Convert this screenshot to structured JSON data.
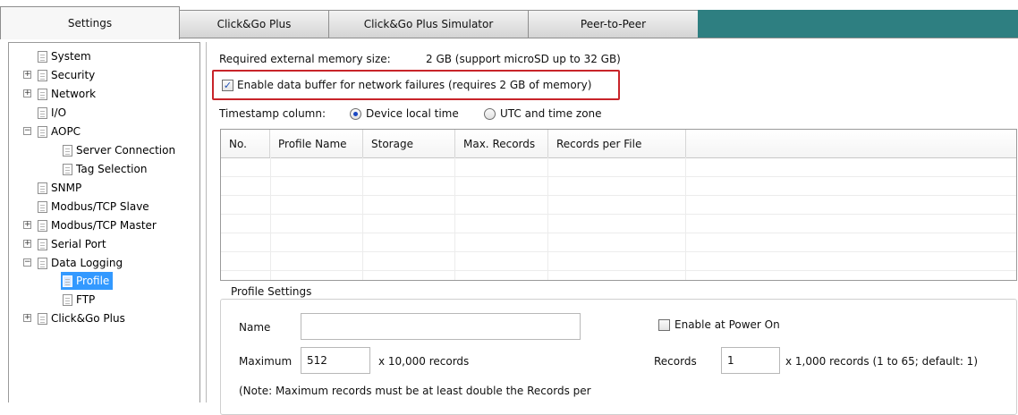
{
  "tabs": [
    {
      "label": "Settings",
      "active": true
    },
    {
      "label": "Click&Go Plus",
      "active": false
    },
    {
      "label": "Click&Go Plus Simulator",
      "active": false
    },
    {
      "label": "Peer-to-Peer",
      "active": false
    }
  ],
  "tree": [
    {
      "label": "System"
    },
    {
      "label": "Security",
      "expander": "+"
    },
    {
      "label": "Network",
      "expander": "+"
    },
    {
      "label": "I/O"
    },
    {
      "label": "AOPC",
      "expander": "−"
    },
    {
      "label": "Server Connection"
    },
    {
      "label": "Tag Selection"
    },
    {
      "label": "SNMP"
    },
    {
      "label": "Modbus/TCP Slave"
    },
    {
      "label": "Modbus/TCP Master",
      "expander": "+"
    },
    {
      "label": "Serial Port",
      "expander": "+"
    },
    {
      "label": "Data Logging",
      "expander": "−"
    },
    {
      "label": "Profile",
      "selected": true
    },
    {
      "label": "FTP"
    },
    {
      "label": "Click&Go Plus",
      "expander": "+"
    }
  ],
  "memory": {
    "label": "Required external memory size:",
    "value": "2  GB (support microSD up to 32 GB)"
  },
  "buffer": {
    "checked_mark": "✓",
    "label": "Enable data buffer for network failures (requires 2 GB of memory)"
  },
  "timestamp": {
    "label": "Timestamp column:",
    "options": [
      {
        "label": "Device local time",
        "selected": true
      },
      {
        "label": "UTC and time zone",
        "selected": false
      }
    ]
  },
  "table": {
    "columns": [
      "No.",
      "Profile Name",
      "Storage",
      "Max. Records",
      "Records per File"
    ]
  },
  "profile_settings": {
    "title": "Profile Settings",
    "name_label": "Name",
    "name_value": "",
    "enable_power_on_label": "Enable at Power On",
    "maximum_label": "Maximum",
    "maximum_value": "512",
    "maximum_unit": "x 10,000 records",
    "records_label": "Records",
    "records_value": "1",
    "records_unit": "x 1,000 records (1 to 65; default: 1)",
    "note": "(Note: Maximum records must be at least double the Records per"
  },
  "colors": {
    "tab_fill": "#2e7f81",
    "selection": "#3399ff",
    "highlight_border": "#c8242a"
  }
}
